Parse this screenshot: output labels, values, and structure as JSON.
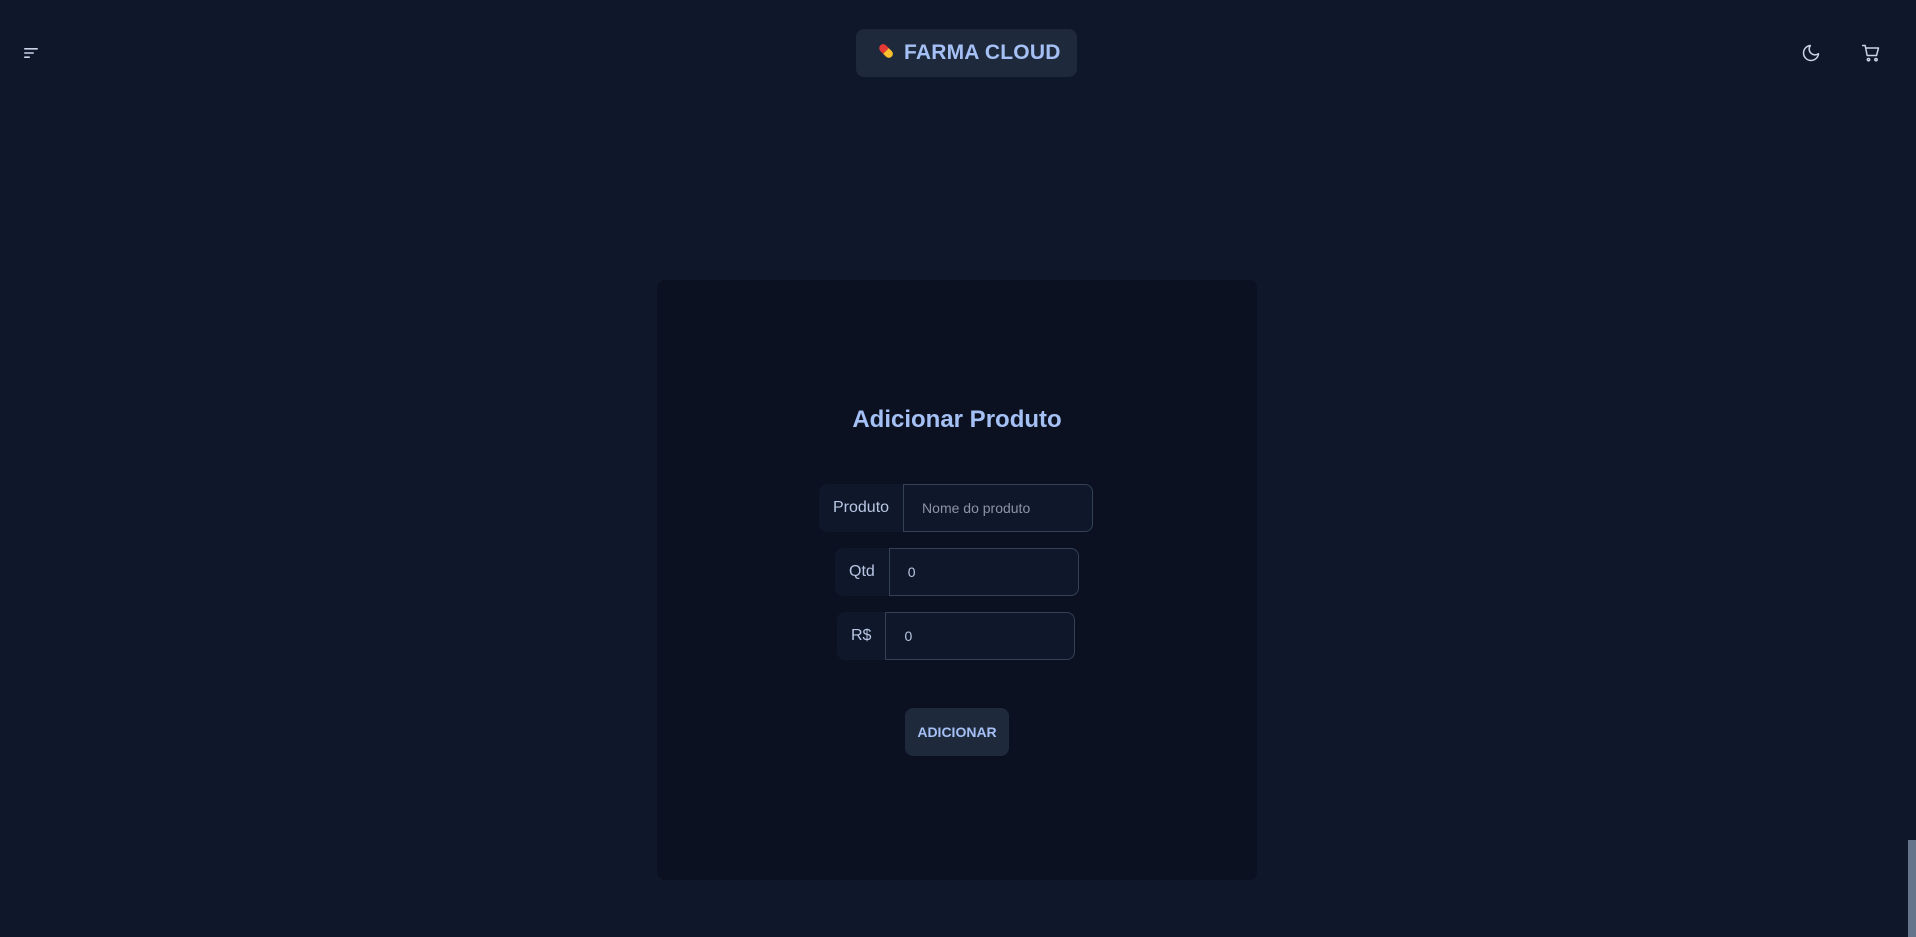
{
  "navbar": {
    "menu_icon": "hamburger-menu-icon",
    "brand_emoji": "💊",
    "brand_text": "FARMA CLOUD",
    "theme_icon": "moon-icon",
    "cart_icon": "cart-icon"
  },
  "form": {
    "title": "Adicionar Produto",
    "product_label": "Produto",
    "product_placeholder": "Nome do produto",
    "qty_label": "Qtd",
    "qty_value": "0",
    "price_label": "R$",
    "price_value": "0",
    "submit_label": "ADICIONAR"
  },
  "colors": {
    "background": "#0f172a",
    "card": "#0b1120",
    "accent": "#a5c0f5",
    "button": "#1e293b"
  }
}
